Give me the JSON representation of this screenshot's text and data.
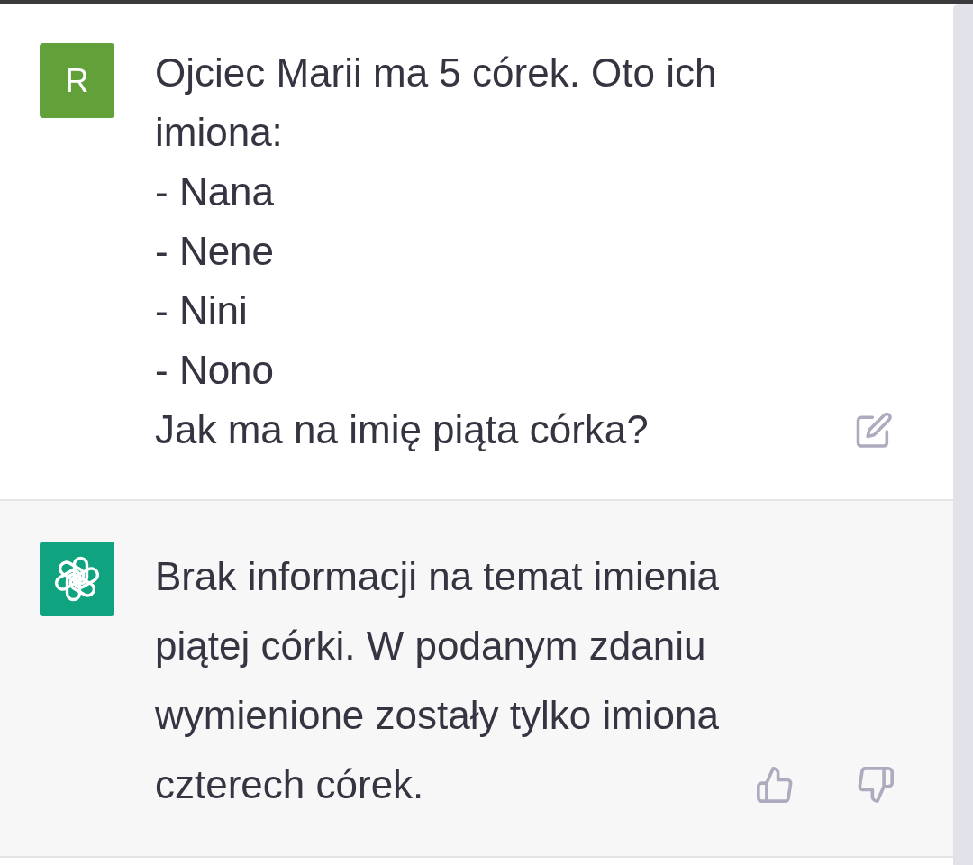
{
  "messages": [
    {
      "kind": "user",
      "avatar": "R",
      "text": "Ojciec Marii ma 5 córek. Oto ich imiona:\n- Nana\n- Nene\n- Nini\n- Nono\nJak ma na imię piąta córka?"
    },
    {
      "kind": "assistant",
      "text": "Brak informacji na temat imienia piątej córki. W podanym zdaniu wymienione zostały tylko imiona czterech córek."
    }
  ]
}
